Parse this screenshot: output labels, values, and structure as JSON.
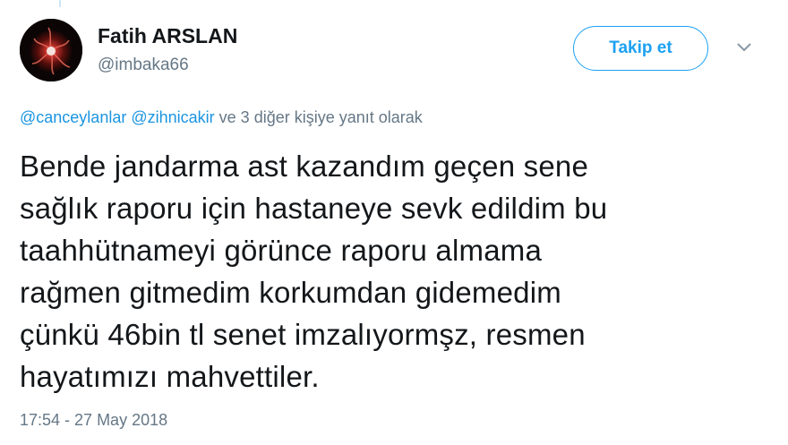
{
  "colors": {
    "accent": "#1da1f2",
    "link": "#1b95e0",
    "text_primary": "#14171a",
    "text_secondary": "#657786"
  },
  "author": {
    "name": "Fatih ARSLAN",
    "handle": "@imbaka66"
  },
  "actions": {
    "follow_label": "Takip et",
    "more_icon": "chevron-down-icon"
  },
  "reply_context": {
    "mention_1": "@canceylanlar",
    "mention_2": "@zihnicakir",
    "suffix": "ve 3 diğer kişiye yanıt olarak"
  },
  "tweet": {
    "lines": [
      "Bende jandarma ast kazandım geçen sene",
      "sağlık raporu için hastaneye sevk edildim bu",
      "taahhütnameyi görünce raporu almama",
      "rağmen gitmedim korkumdan gidemedim",
      "çünkü 46bin tl senet imzalıyormşz, resmen",
      "hayatımızı mahvettiler."
    ],
    "timestamp": "17:54 - 27 May 2018"
  }
}
